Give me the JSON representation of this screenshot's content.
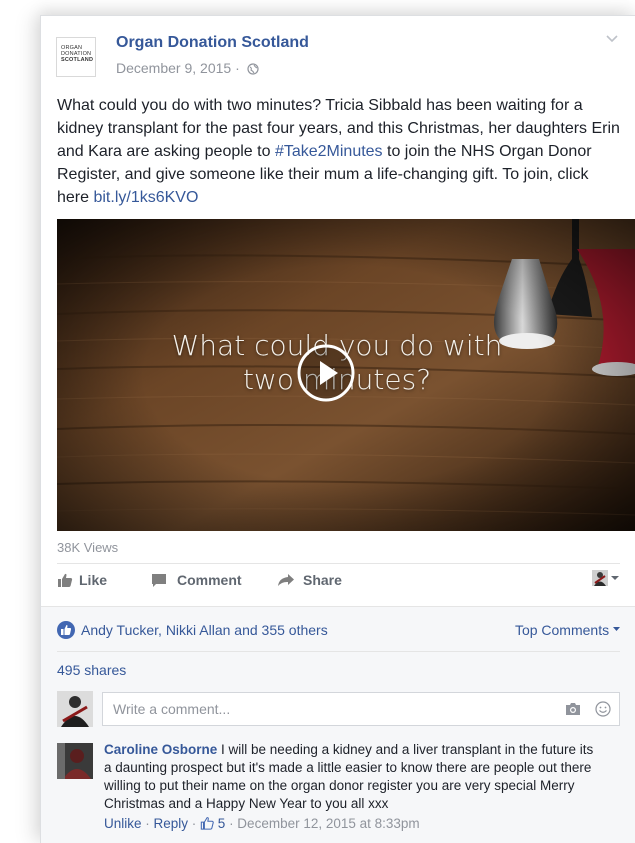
{
  "post": {
    "page_logo": {
      "line1": "ORGAN",
      "line2": "DONATION",
      "line3": "SCOTLAND"
    },
    "page_name": "Organ Donation Scotland",
    "date": "December 9, 2015 ·",
    "text_1": "What could you do with two minutes? Tricia Sibbald has been waiting for a kidney transplant for the past four years, and this Christmas, her daughters Erin and Kara are asking people to ",
    "hashtag": "#Take2Minutes",
    "text_2": " to join the NHS Organ Donor Register, and give someone like their mum a life-changing gift. To join, click here ",
    "link": "bit.ly/1ks6KVO"
  },
  "video": {
    "caption_line1": "What could you do with",
    "caption_line2": "two minutes?",
    "views": "38K Views"
  },
  "actions": {
    "like": "Like",
    "comment": "Comment",
    "share": "Share"
  },
  "reactions": {
    "names": "Andy Tucker, Nikki Allan and 355 others",
    "top_comments": "Top Comments",
    "shares": "495 shares"
  },
  "composer": {
    "placeholder": "Write a comment..."
  },
  "comment": {
    "author": "Caroline Osborne",
    "text": " I will be needing a kidney and a liver transplant in the future its a daunting prospect but it's made a little easier to know there are people out there willing to put their name on the organ donor register you are very special Merry Christmas and a Happy New Year to you all xxx",
    "unlike": "Unlike",
    "sep1": " · ",
    "reply": "Reply",
    "sep2": " · ",
    "like_count": "5",
    "timestamp": " · December 12, 2015 at 8:33pm"
  },
  "colors": {
    "link": "#365899",
    "muted": "#90949c",
    "like_blue": "#4267b2"
  },
  "icons": [
    "globe-icon",
    "chevron-down-icon",
    "play-icon",
    "thumbs-up-icon",
    "comment-icon",
    "share-icon",
    "camera-icon",
    "smile-icon"
  ]
}
